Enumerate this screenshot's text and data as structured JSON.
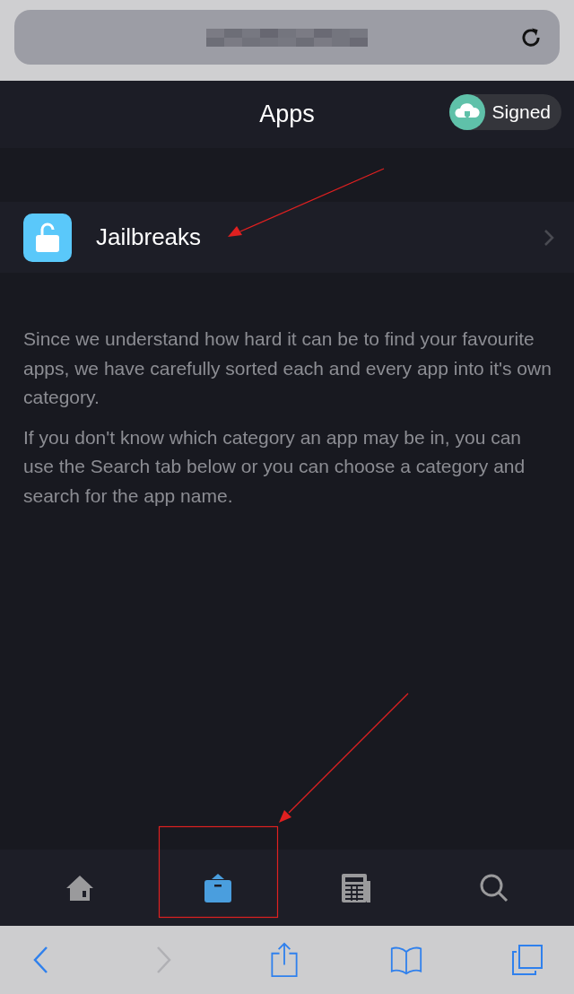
{
  "browser": {
    "address_blurred": true
  },
  "header": {
    "title": "Apps",
    "badge": "Signed"
  },
  "categories": [
    {
      "label": "Jailbreaks"
    }
  ],
  "paragraphs": [
    "Since we understand how hard it can be to find your favourite apps, we have carefully sorted each and every app into it's own category.",
    "If you don't know which category an app may be in, you can use the Search tab below or you can choose a category and search for the app name."
  ],
  "tabs": [
    {
      "kind": "home",
      "selected": false
    },
    {
      "kind": "box",
      "selected": true
    },
    {
      "kind": "news",
      "selected": false
    },
    {
      "kind": "search",
      "selected": false
    }
  ],
  "toolbar": [
    {
      "kind": "back",
      "disabled": false
    },
    {
      "kind": "forward",
      "disabled": true
    },
    {
      "kind": "share",
      "disabled": false
    },
    {
      "kind": "bookmarks",
      "disabled": false
    },
    {
      "kind": "tabs",
      "disabled": false
    }
  ]
}
